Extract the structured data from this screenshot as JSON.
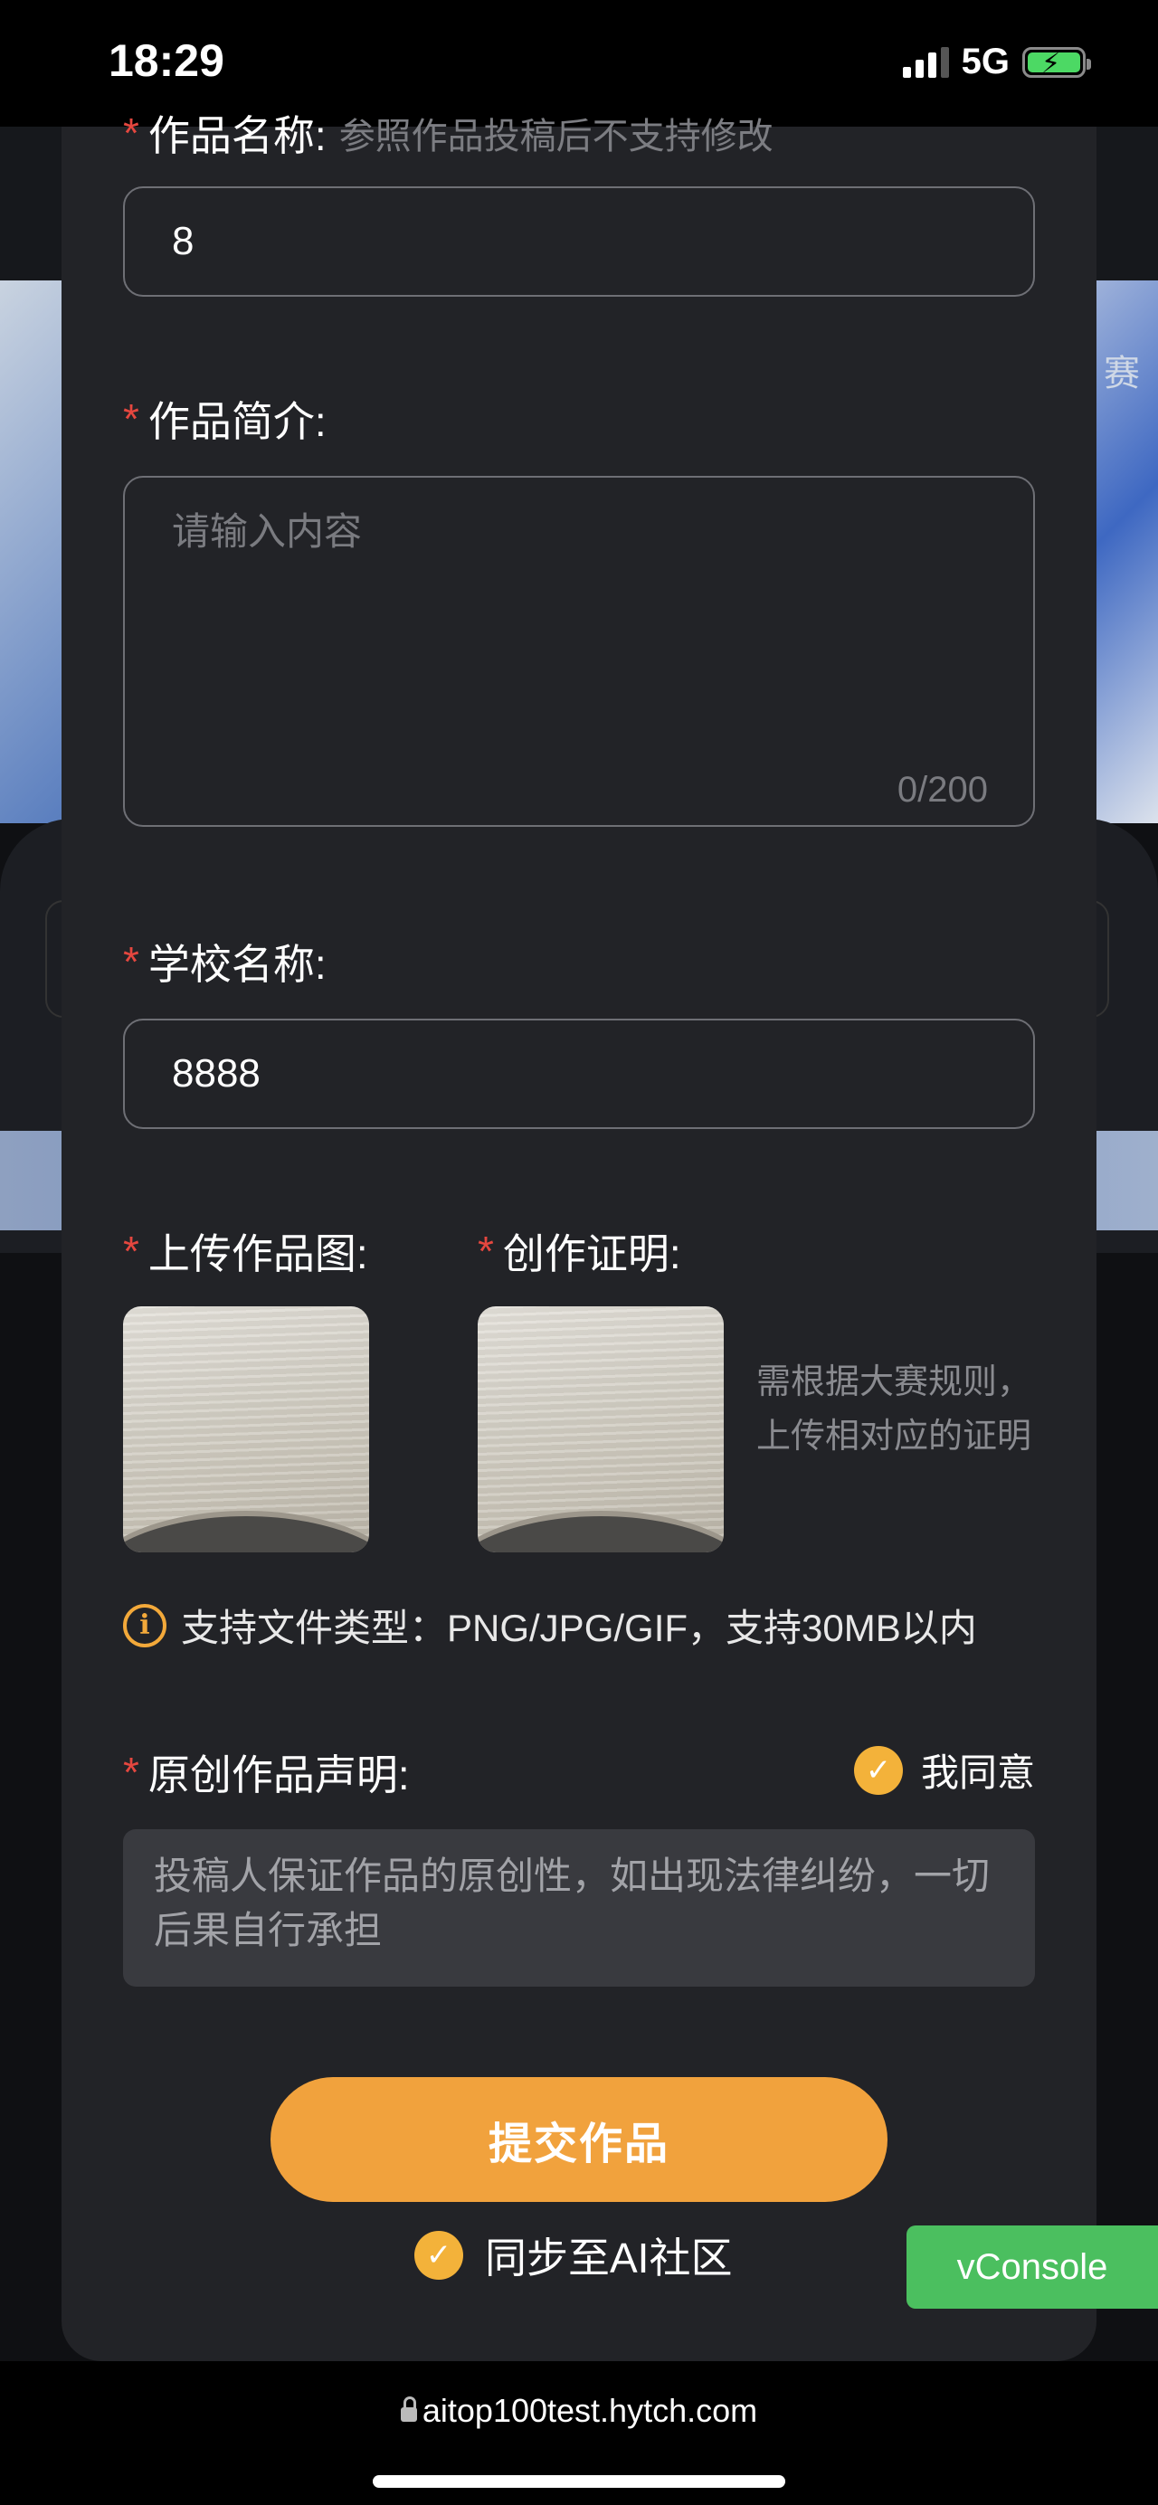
{
  "status_bar": {
    "time": "18:29",
    "network": "5G"
  },
  "background": {
    "banner_text": "赛"
  },
  "form": {
    "work_name": {
      "label": "作品名称:",
      "hint": "参照作品投稿后不支持修改",
      "value": "8"
    },
    "intro": {
      "label": "作品简介:",
      "placeholder": "请输入内容",
      "counter": "0/200"
    },
    "school": {
      "label": "学校名称:",
      "value": "8888"
    },
    "upload_image": {
      "label": "上传作品图:"
    },
    "creation_proof": {
      "label": "创作证明:",
      "note": "需根据大赛规则， 上传相对应的证明"
    },
    "file_support": "支持文件类型：PNG/JPG/GIF，支持30MB以内",
    "statement": {
      "label": "原创作品声明:",
      "agree_label": "我同意",
      "text": "投稿人保证作品的原创性，如出现法律纠纷，一切后果自行承担"
    },
    "submit_label": "提交作品",
    "sync_label": "同步至AI社区"
  },
  "vconsole_label": "vConsole",
  "browser": {
    "url": "aitop100test.hytch.com"
  },
  "icons": {
    "info": "info-icon",
    "check": "check-icon",
    "lock": "lock-icon"
  },
  "colors": {
    "accent": "#f1a23d",
    "required": "#e5473f",
    "sheet_bg": "#222327",
    "vconsole": "#4bbf5f"
  }
}
